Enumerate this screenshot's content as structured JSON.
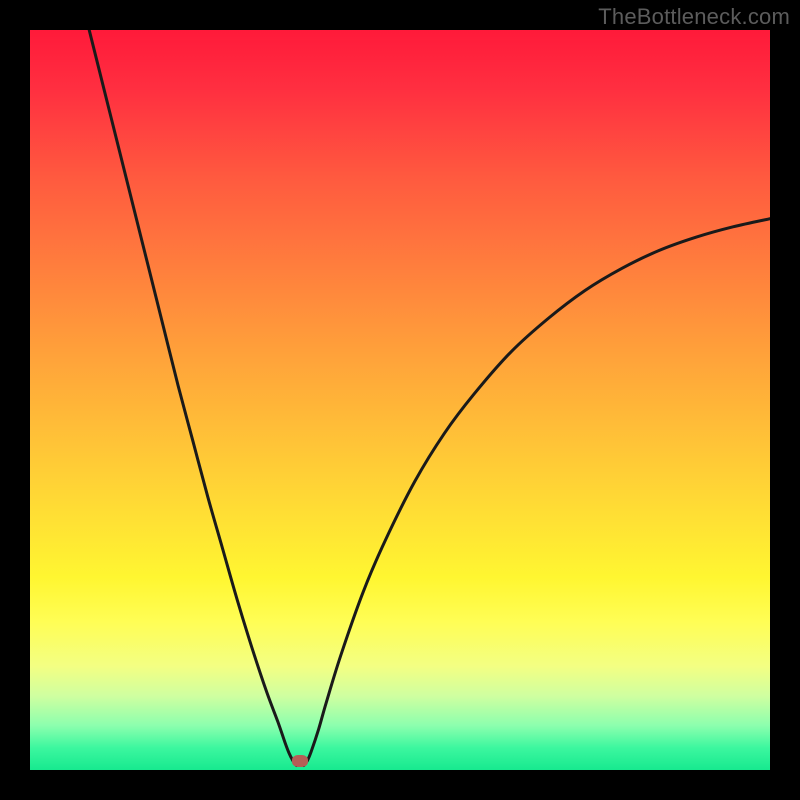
{
  "watermark": "TheBottleneck.com",
  "colors": {
    "frame": "#000000",
    "gradient_top": "#ff1a3a",
    "gradient_bottom": "#17e98f",
    "curve_stroke": "#1a1a1a",
    "marker_fill": "#b65e56"
  },
  "chart_data": {
    "type": "line",
    "title": "",
    "xlabel": "",
    "ylabel": "",
    "xlim": [
      0,
      100
    ],
    "ylim": [
      0,
      100
    ],
    "axes_visible": false,
    "grid": false,
    "background": "vertical-gradient red→green",
    "left_branch": {
      "x": [
        8,
        10,
        12,
        14,
        16,
        18,
        20,
        22,
        24,
        26,
        28,
        30,
        32,
        33.5,
        34.5,
        35,
        35.5,
        36
      ],
      "y": [
        100,
        92,
        84,
        76,
        68,
        60,
        52,
        44.5,
        37,
        30,
        23,
        16.5,
        10.5,
        6.5,
        3.6,
        2.3,
        1.3,
        0.6
      ]
    },
    "right_branch": {
      "x": [
        37,
        37.5,
        38,
        39,
        40,
        42,
        45,
        48,
        52,
        56,
        60,
        65,
        70,
        75,
        80,
        85,
        90,
        95,
        100
      ],
      "y": [
        0.6,
        1.3,
        2.5,
        5.5,
        9,
        15.5,
        24,
        31,
        39,
        45.5,
        50.8,
        56.5,
        61,
        64.8,
        67.8,
        70.2,
        72,
        73.4,
        74.5
      ]
    },
    "marker": {
      "x": 36.5,
      "y": 1.2
    },
    "annotations": [
      "TheBottleneck.com"
    ]
  }
}
